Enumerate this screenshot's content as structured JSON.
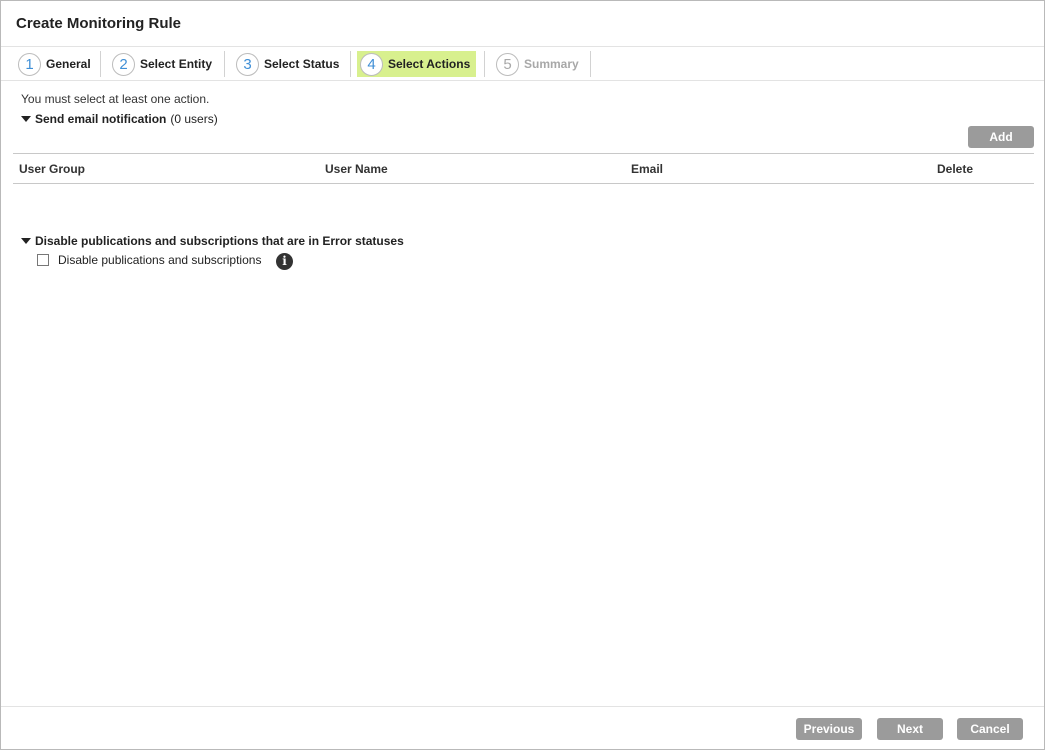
{
  "dialog": {
    "title": "Create Monitoring Rule"
  },
  "wizard": {
    "steps": [
      {
        "number": "1",
        "label": "General",
        "state": "done"
      },
      {
        "number": "2",
        "label": "Select Entity",
        "state": "done"
      },
      {
        "number": "3",
        "label": "Select Status",
        "state": "done"
      },
      {
        "number": "4",
        "label": "Select Actions",
        "state": "active"
      },
      {
        "number": "5",
        "label": "Summary",
        "state": "disabled"
      }
    ]
  },
  "content": {
    "hint": "You must select at least one action.",
    "email_section": {
      "title": "Send email notification",
      "count": "(0 users)",
      "add_label": "Add",
      "columns": [
        "User Group",
        "User Name",
        "Email",
        "Delete"
      ],
      "rows": []
    },
    "disable_section": {
      "title": "Disable publications and subscriptions that are in Error statuses",
      "checkbox_label": "Disable publications and subscriptions",
      "checked": false,
      "info_icon": "info-icon"
    }
  },
  "footer": {
    "previous_label": "Previous",
    "next_label": "Next",
    "cancel_label": "Cancel"
  },
  "colors": {
    "active_step_bg": "#d8f08e",
    "step_number": "#3f8fd6",
    "button_bg": "#9b9b9b"
  }
}
